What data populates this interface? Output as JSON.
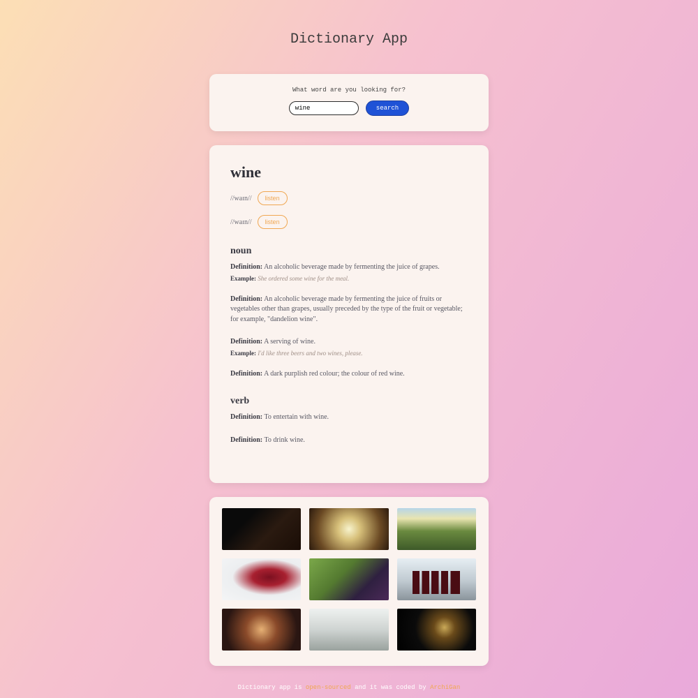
{
  "title": "Dictionary App",
  "search": {
    "prompt": "What word are you looking for?",
    "value": "wine",
    "button": "search"
  },
  "entry": {
    "word": "wine",
    "phonetics": [
      {
        "text": "//waɪn//",
        "listen": "listen"
      },
      {
        "text": "//waɪn//",
        "listen": "listen"
      }
    ],
    "sections": [
      {
        "partOfSpeech": "noun",
        "defs": [
          {
            "definition": "An alcoholic beverage made by fermenting the juice of grapes.",
            "example": "She ordered some wine for the meal."
          },
          {
            "definition": "An alcoholic beverage made by fermenting the juice of fruits or vegetables other than grapes, usually preceded by the type of the fruit or vegetable; for example, \"dandelion wine\"."
          },
          {
            "definition": "A serving of wine.",
            "example": "I'd like three beers and two wines, please."
          },
          {
            "definition": "A dark purplish red colour; the colour of red wine."
          }
        ]
      },
      {
        "partOfSpeech": "verb",
        "defs": [
          {
            "definition": "To entertain with wine."
          },
          {
            "definition": "To drink wine."
          }
        ]
      }
    ]
  },
  "labels": {
    "definition": "Definition:",
    "example": "Example:"
  },
  "footer": {
    "t1": "Dictionary app is ",
    "link1": "open-sourced",
    "t2": " and it was coded by ",
    "link2": "ArchiGan"
  }
}
